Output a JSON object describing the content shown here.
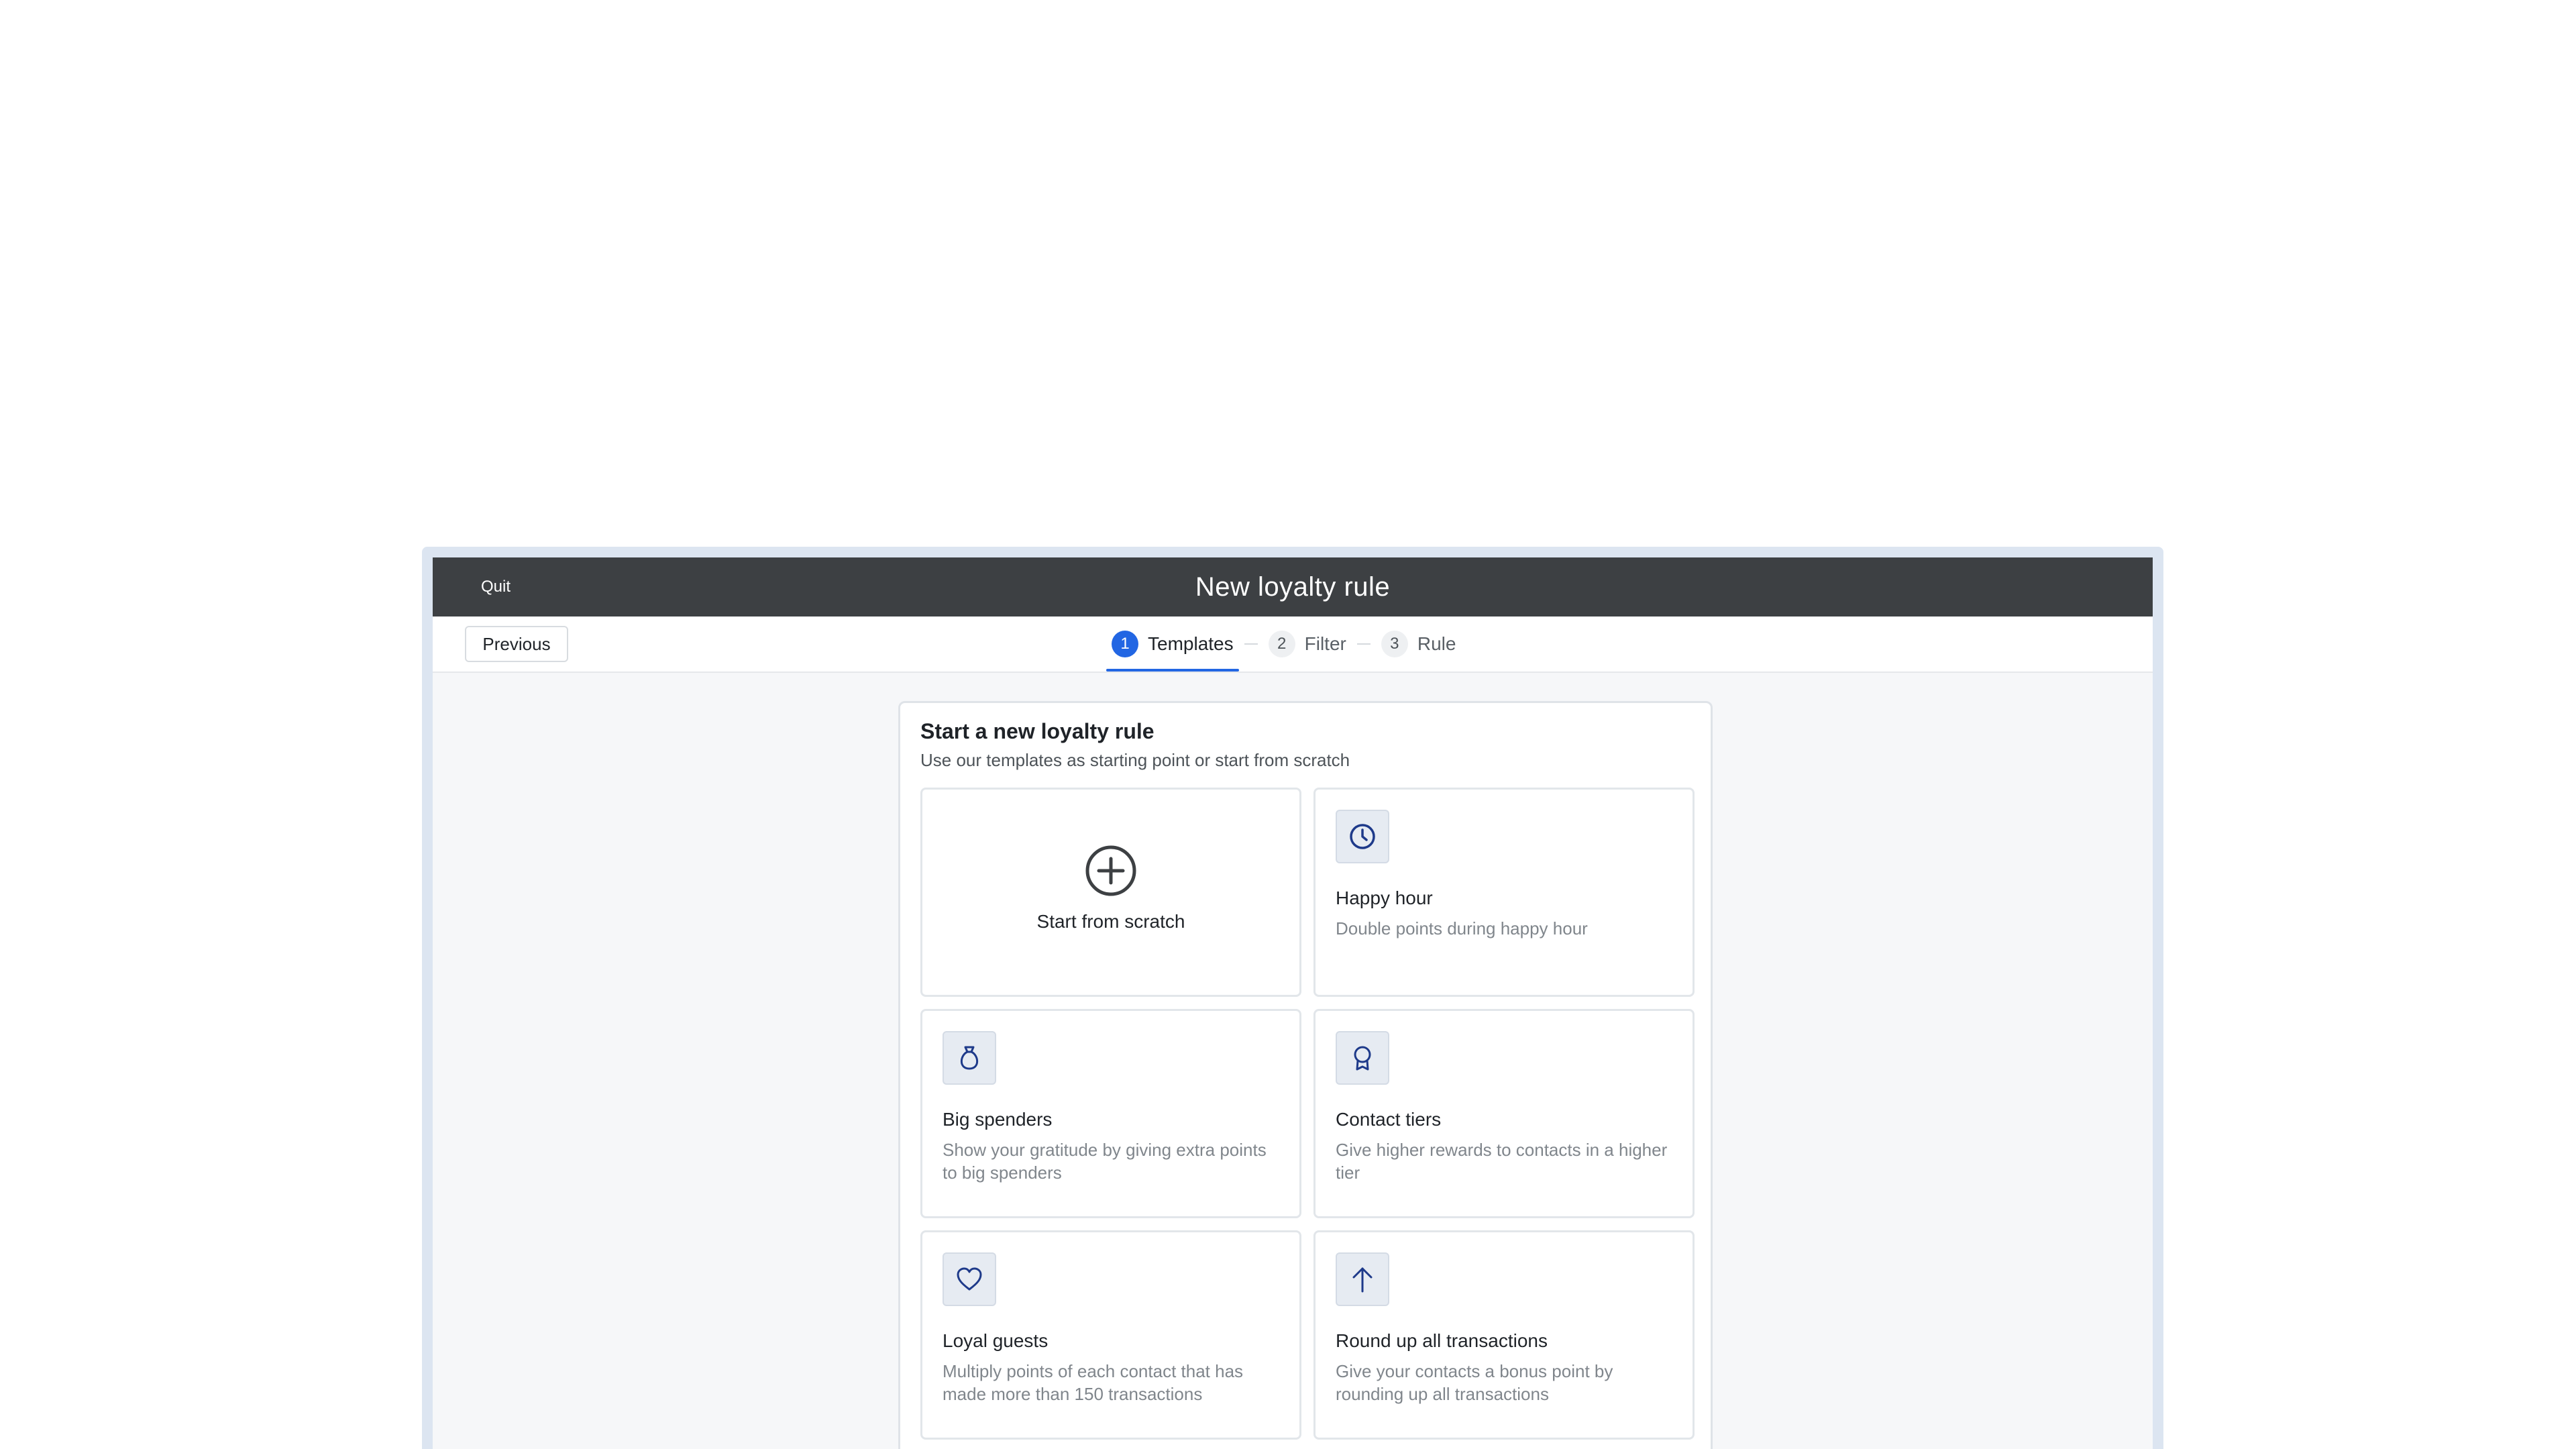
{
  "titlebar": {
    "quit_label": "Quit",
    "title": "New loyalty rule"
  },
  "stepbar": {
    "previous_label": "Previous",
    "steps": [
      {
        "number": "1",
        "label": "Templates",
        "active": true
      },
      {
        "number": "2",
        "label": "Filter",
        "active": false
      },
      {
        "number": "3",
        "label": "Rule",
        "active": false
      }
    ]
  },
  "card": {
    "title": "Start a new loyalty rule",
    "subtitle": "Use our templates as starting point or start from scratch",
    "scratch": {
      "label": "Start from scratch",
      "icon": "plus-circle-icon"
    },
    "templates": [
      {
        "icon": "clock-icon",
        "title": "Happy hour",
        "description": "Double points during happy hour"
      },
      {
        "icon": "money-bag-icon",
        "title": "Big spenders",
        "description": "Show your gratitude by giving extra points to big spenders"
      },
      {
        "icon": "award-ribbon-icon",
        "title": "Contact tiers",
        "description": "Give higher rewards to contacts in a higher tier"
      },
      {
        "icon": "heart-icon",
        "title": "Loyal guests",
        "description": "Multiply points of each contact that has made more than 150 transactions"
      },
      {
        "icon": "arrow-up-icon",
        "title": "Round up all transactions",
        "description": "Give your contacts a bonus point by rounding up all transactions"
      }
    ]
  },
  "colors": {
    "accent": "#2266e3",
    "titlebar": "#3d4043",
    "icon": "#1e3a8a"
  }
}
